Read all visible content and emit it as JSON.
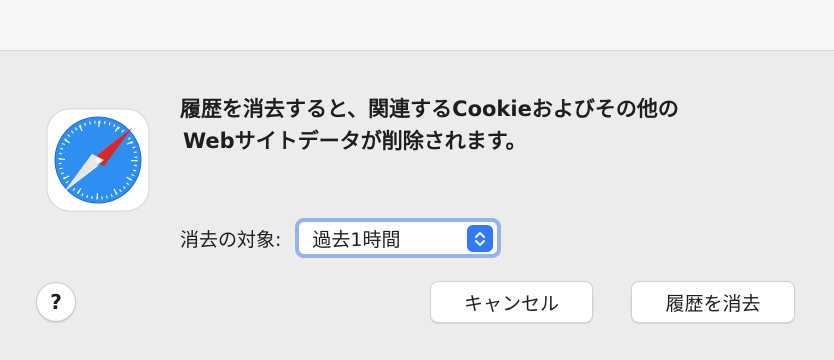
{
  "dialog": {
    "app_icon": "safari-compass-icon",
    "message_line1": "履歴を消去すると、関連するCookieおよびその他の",
    "message_line2": "Webサイトデータが削除されます。",
    "range_label": "消去の対象:",
    "range_value": "過去1時間",
    "stepper_icon": "chevron-up-down-icon",
    "help_label": "?",
    "cancel_label": "キャンセル",
    "clear_label": "履歴を消去"
  },
  "colors": {
    "accent": "#3478f6",
    "focus_ring": "#96b2e7",
    "dialog_bg": "#ececec",
    "button_bg": "#ffffff"
  }
}
